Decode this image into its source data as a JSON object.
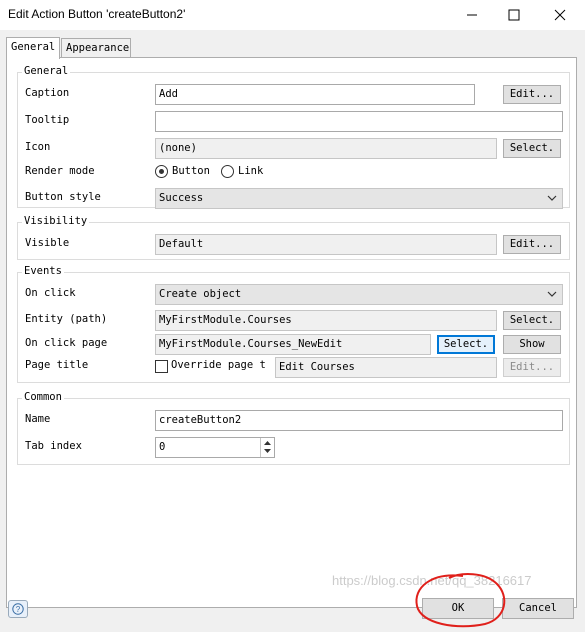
{
  "window": {
    "title": "Edit Action Button 'createButton2'"
  },
  "tabs": [
    {
      "label": "General"
    },
    {
      "label": "Appearance"
    }
  ],
  "general": {
    "title": "General",
    "caption": {
      "label": "Caption",
      "value": "Add",
      "edit": "Edit..."
    },
    "tooltip": {
      "label": "Tooltip",
      "value": ""
    },
    "icon": {
      "label": "Icon",
      "value": "(none)",
      "select": "Select."
    },
    "render_mode": {
      "label": "Render mode",
      "options": [
        "Button",
        "Link"
      ],
      "selected": "Button"
    },
    "button_style": {
      "label": "Button style",
      "value": "Success"
    }
  },
  "visibility": {
    "title": "Visibility",
    "visible": {
      "label": "Visible",
      "value": "Default",
      "edit": "Edit..."
    }
  },
  "events": {
    "title": "Events",
    "on_click": {
      "label": "On click",
      "value": "Create object"
    },
    "entity": {
      "label": "Entity (path)",
      "value": "MyFirstModule.Courses",
      "select": "Select."
    },
    "on_click_page": {
      "label": "On click page",
      "value": "MyFirstModule.Courses_NewEdit",
      "select": "Select.",
      "show": "Show"
    },
    "page_title": {
      "label": "Page title",
      "override_label": "Override page t",
      "value": "Edit Courses",
      "edit": "Edit..."
    }
  },
  "common": {
    "title": "Common",
    "name": {
      "label": "Name",
      "value": "createButton2"
    },
    "tab_index": {
      "label": "Tab index",
      "value": "0"
    }
  },
  "footer": {
    "ok": "OK",
    "cancel": "Cancel"
  },
  "watermark": "https://blog.csdn.net/qq_38216617",
  "colors": {
    "annotation_circle": "#e0201b",
    "focus_blue": "#0078d7"
  }
}
